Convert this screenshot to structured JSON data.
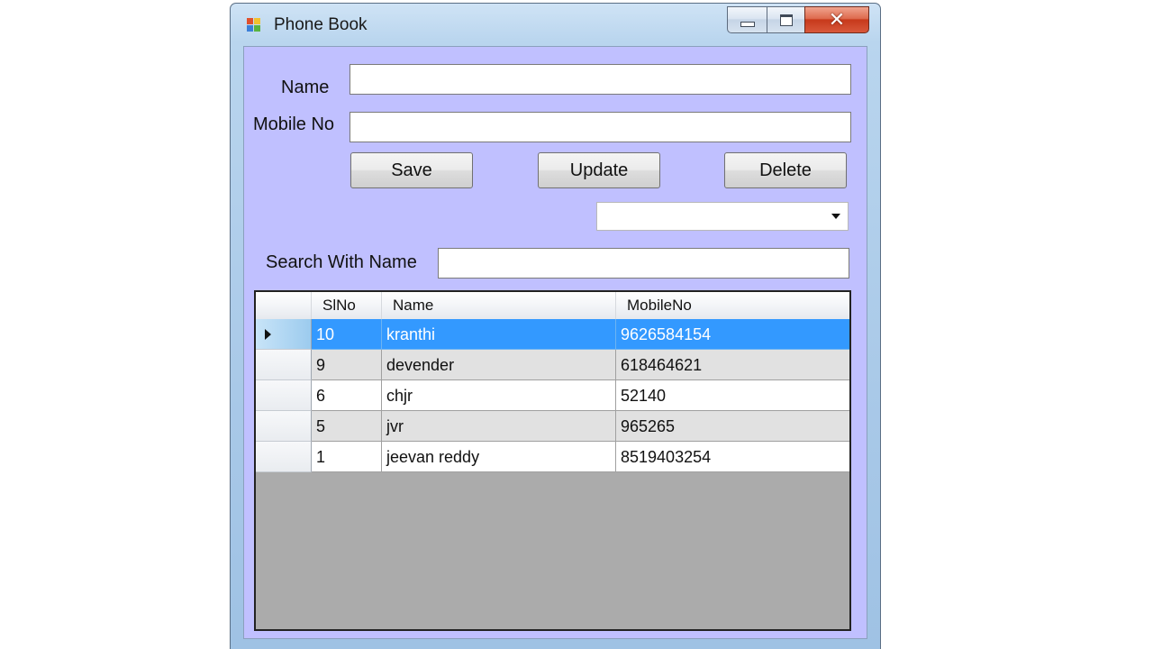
{
  "window": {
    "title": "Phone Book"
  },
  "form": {
    "name_label": "Name",
    "name_value": "",
    "mobile_label": "Mobile No",
    "mobile_value": "",
    "save_label": "Save",
    "update_label": "Update",
    "delete_label": "Delete",
    "combo_value": "",
    "search_label": "Search With Name",
    "search_value": ""
  },
  "grid": {
    "columns": [
      "SlNo",
      "Name",
      "MobileNo"
    ],
    "rows": [
      {
        "slno": "10",
        "name": "kranthi",
        "mobile": "9626584154",
        "selected": true
      },
      {
        "slno": "9",
        "name": "devender",
        "mobile": "618464621",
        "selected": false
      },
      {
        "slno": "6",
        "name": "chjr",
        "mobile": "52140",
        "selected": false
      },
      {
        "slno": "5",
        "name": "jvr",
        "mobile": "965265",
        "selected": false
      },
      {
        "slno": "1",
        "name": "jeevan reddy",
        "mobile": "8519403254",
        "selected": false
      }
    ]
  },
  "icons": {
    "app": "app-window-icon",
    "minimize": "minimize-icon",
    "maximize": "restore-icon",
    "close": "close-icon",
    "dropdown": "chevron-down-icon",
    "row_pointer": "row-pointer-icon"
  },
  "colors": {
    "client_bg": "#c0c0ff",
    "selection": "#3399ff",
    "grid_empty": "#ababab"
  }
}
